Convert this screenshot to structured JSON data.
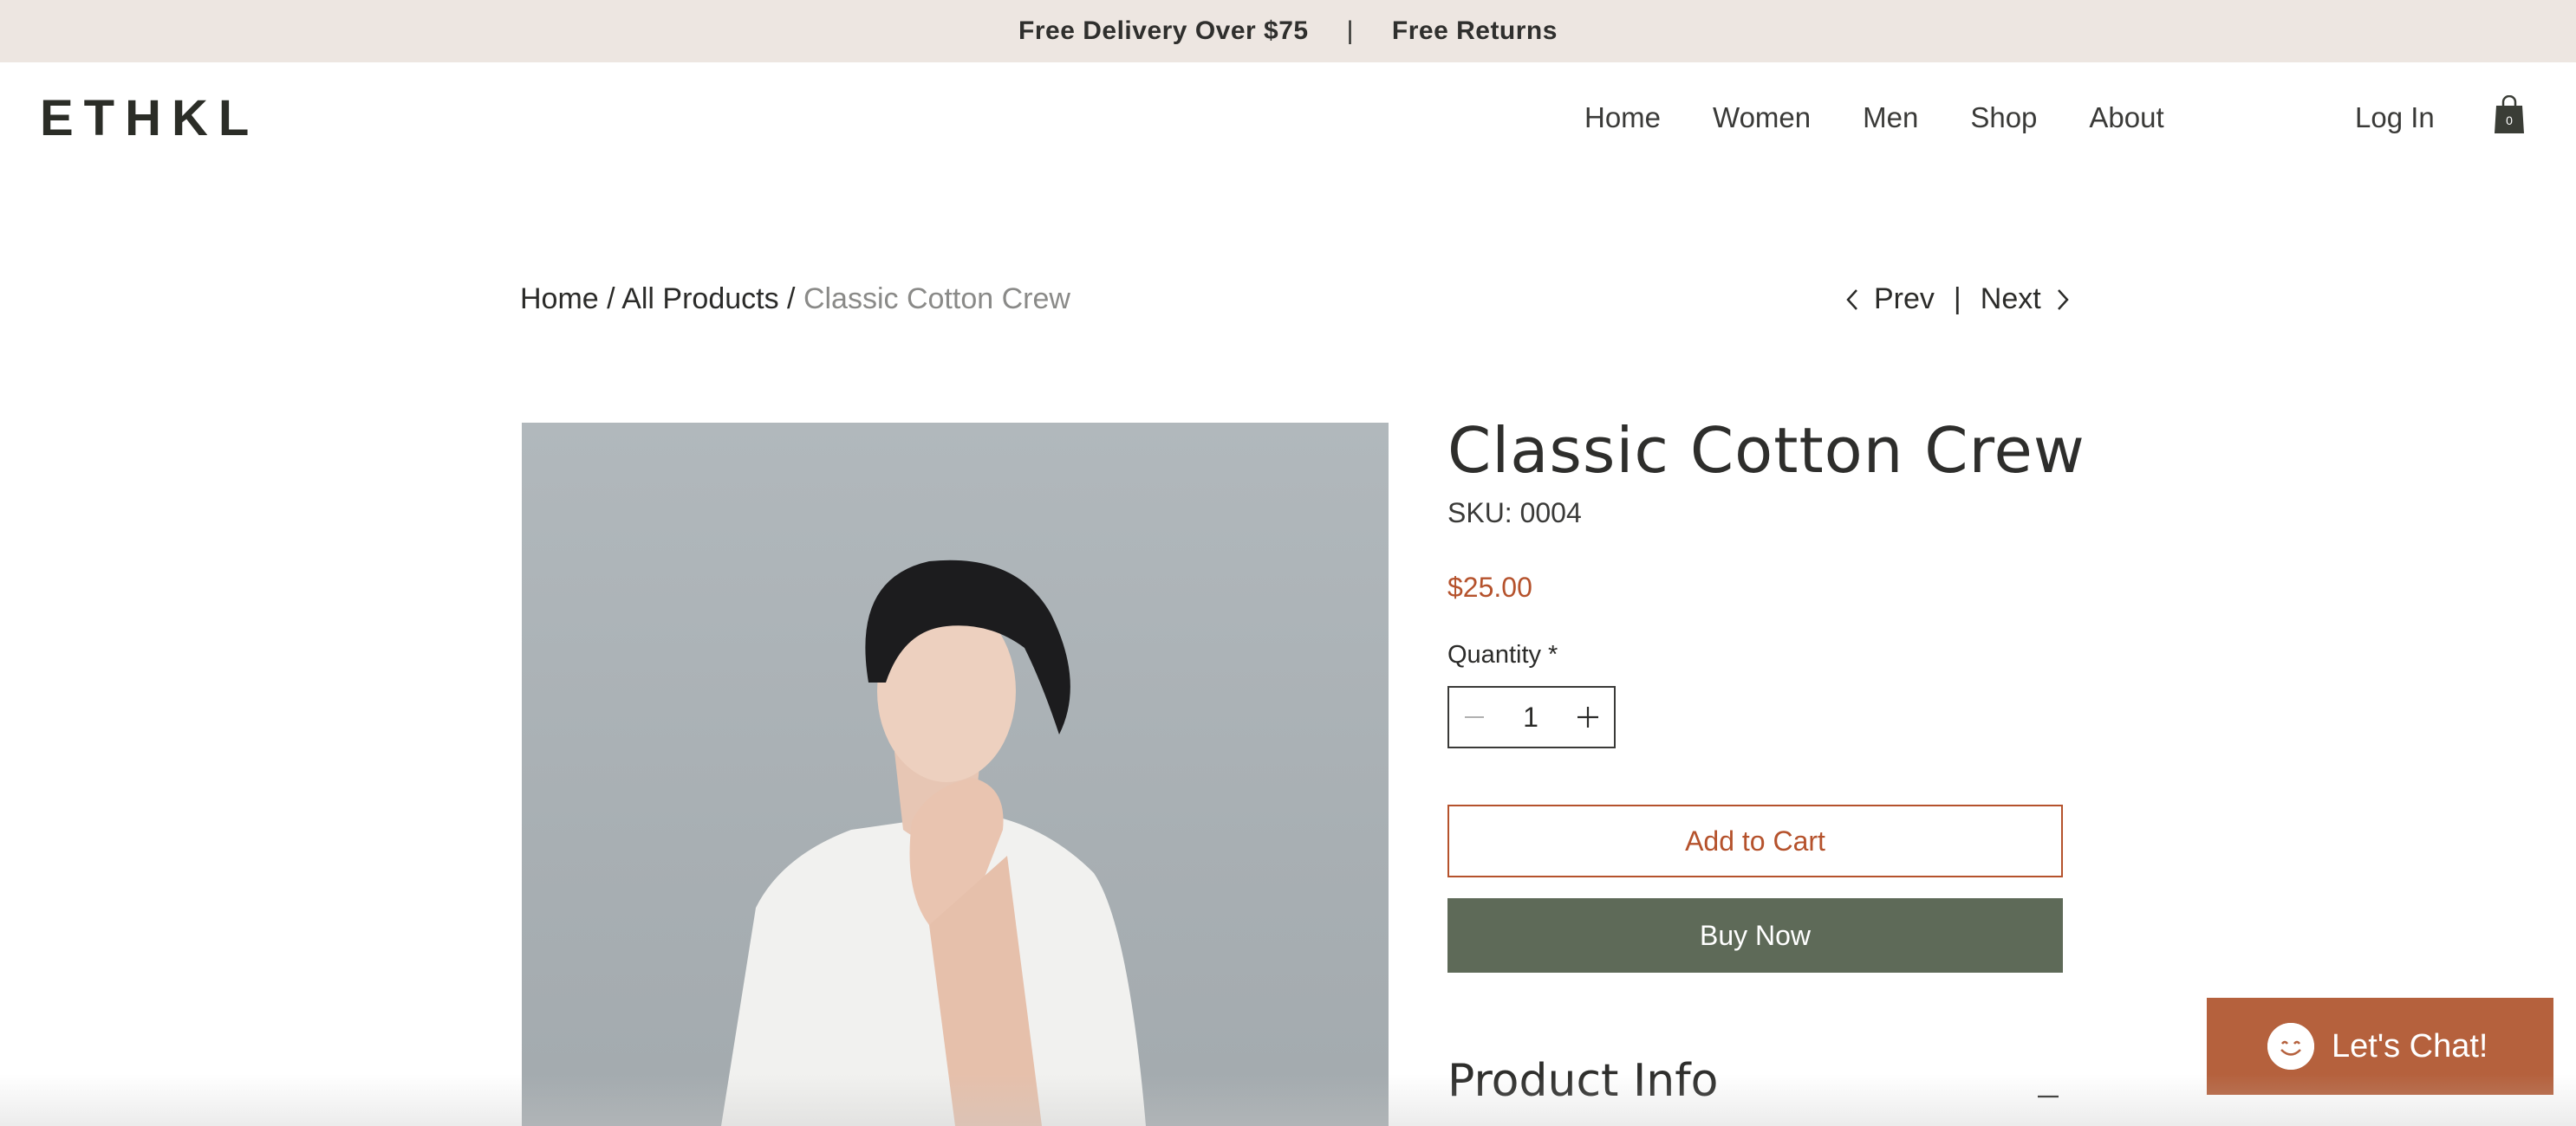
{
  "promo": {
    "left": "Free Delivery Over $75",
    "separator": "|",
    "right": "Free Returns"
  },
  "header": {
    "logo": "ETHKL",
    "nav": [
      "Home",
      "Women",
      "Men",
      "Shop",
      "About"
    ],
    "login": "Log In",
    "cart_count": "0"
  },
  "breadcrumb": {
    "home": "Home",
    "sep": "/",
    "all": "All Products",
    "current": "Classic Cotton Crew"
  },
  "pager": {
    "prev": "Prev",
    "next": "Next",
    "divider": "|"
  },
  "product": {
    "title": "Classic Cotton Crew",
    "sku": "SKU: 0004",
    "price": "$25.00",
    "quantity_label": "Quantity *",
    "quantity_value": "1",
    "add_to_cart": "Add to Cart",
    "buy_now": "Buy Now",
    "info_heading": "Product Info"
  },
  "chat": {
    "label": "Let's Chat!"
  },
  "colors": {
    "accent": "#b5522c",
    "buy_button": "#5e6a58",
    "promo_bg": "#ede6e1",
    "chat_bg": "#b5613d"
  }
}
